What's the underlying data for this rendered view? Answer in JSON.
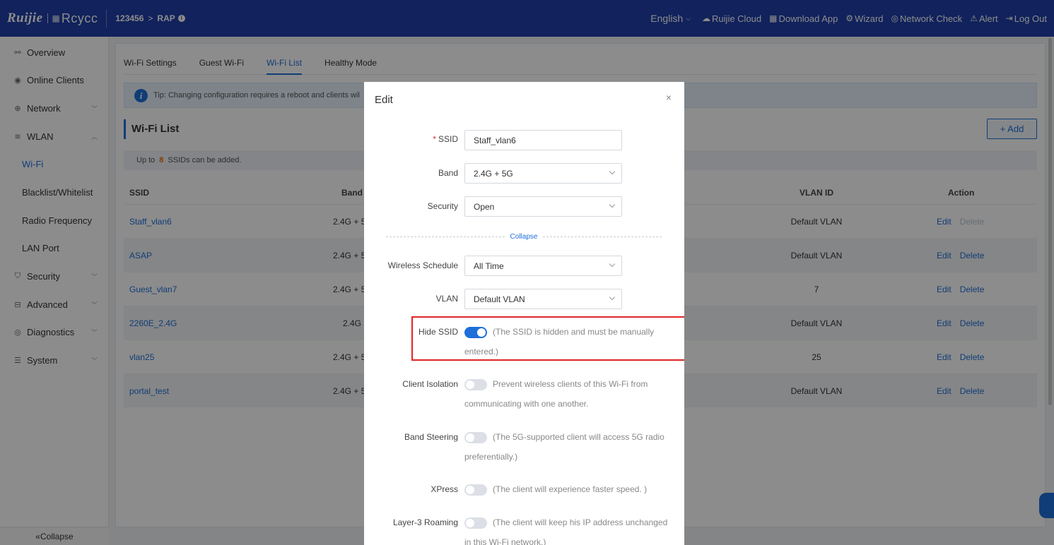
{
  "header": {
    "brand_primary": "Ruijie",
    "brand_secondary": "Rcycc",
    "device_id": "123456",
    "device_mode": "RAP",
    "info_icon": "i",
    "language": "English",
    "links": {
      "cloud": "Ruijie Cloud",
      "download": "Download App",
      "wizard": "Wizard",
      "network_check": "Network Check",
      "alert": "Alert",
      "logout": "Log Out"
    }
  },
  "sidebar": {
    "items": [
      {
        "label": "Overview",
        "icon": "overview-icon"
      },
      {
        "label": "Online Clients",
        "icon": "clients-icon"
      },
      {
        "label": "Network",
        "icon": "globe-icon"
      },
      {
        "label": "WLAN",
        "icon": "wifi-icon"
      },
      {
        "label": "Wi-Fi"
      },
      {
        "label": "Blacklist/Whitelist"
      },
      {
        "label": "Radio Frequency"
      },
      {
        "label": "LAN Port"
      },
      {
        "label": "Security",
        "icon": "shield-icon"
      },
      {
        "label": "Advanced",
        "icon": "briefcase-icon"
      },
      {
        "label": "Diagnostics",
        "icon": "diagnostics-icon"
      },
      {
        "label": "System",
        "icon": "settings-icon"
      }
    ],
    "collapse": "Collapse"
  },
  "tabs": [
    "Wi-Fi Settings",
    "Guest Wi-Fi",
    "Wi-Fi List",
    "Healthy Mode"
  ],
  "active_tab": "Wi-Fi List",
  "tip": "Tip: Changing configuration requires a reboot and clients wil",
  "section_title": "Wi-Fi List",
  "add_button": "+ Add",
  "notice": {
    "prefix": "Up to",
    "count": "8",
    "suffix": "SSIDs can be added."
  },
  "table": {
    "headers": {
      "ssid": "SSID",
      "band": "Band",
      "vlan": "VLAN ID",
      "action": "Action"
    },
    "rows": [
      {
        "ssid": "Staff_vlan6",
        "band": "2.4G + 5",
        "vlan": "Default VLAN",
        "edit": "Edit",
        "delete": "Delete"
      },
      {
        "ssid": "ASAP",
        "band": "2.4G + 5",
        "vlan": "Default VLAN",
        "edit": "Edit",
        "delete": "Delete"
      },
      {
        "ssid": "Guest_vlan7",
        "band": "2.4G + 5",
        "vlan": "7",
        "edit": "Edit",
        "delete": "Delete"
      },
      {
        "ssid": "2260E_2.4G",
        "band": "2.4G",
        "vlan": "Default VLAN",
        "edit": "Edit",
        "delete": "Delete"
      },
      {
        "ssid": "vlan25",
        "band": "2.4G + 5",
        "vlan": "25",
        "edit": "Edit",
        "delete": "Delete"
      },
      {
        "ssid": "portal_test",
        "band": "2.4G + 5",
        "vlan": "Default VLAN",
        "edit": "Edit",
        "delete": "Delete"
      }
    ]
  },
  "modal": {
    "title": "Edit",
    "close": "×",
    "ssid_label": "SSID",
    "ssid_value": "Staff_vlan6",
    "band_label": "Band",
    "band_value": "2.4G + 5G",
    "security_label": "Security",
    "security_value": "Open",
    "collapse": "Collapse",
    "schedule_label": "Wireless Schedule",
    "schedule_value": "All Time",
    "vlan_label": "VLAN",
    "vlan_value": "Default VLAN",
    "hide_ssid_label": "Hide SSID",
    "hide_ssid_on": true,
    "hide_ssid_desc": "(The SSID is hidden and must be manually entered.)",
    "isolation_label": "Client Isolation",
    "isolation_on": false,
    "isolation_desc": "Prevent wireless clients of this Wi-Fi from communicating with one another.",
    "steering_label": "Band Steering",
    "steering_on": false,
    "steering_desc": "(The 5G-supported client will access 5G radio preferentially.)",
    "xpress_label": "XPress",
    "xpress_on": false,
    "xpress_desc": "(The client will experience faster speed. )",
    "roaming_label": "Layer-3 Roaming",
    "roaming_on": false,
    "roaming_desc": "(The client will keep his IP address unchanged in this Wi-Fi network.)"
  },
  "colors": {
    "header": "#1f3fa8",
    "accent": "#1e6fd9",
    "highlight": "#e02424"
  }
}
